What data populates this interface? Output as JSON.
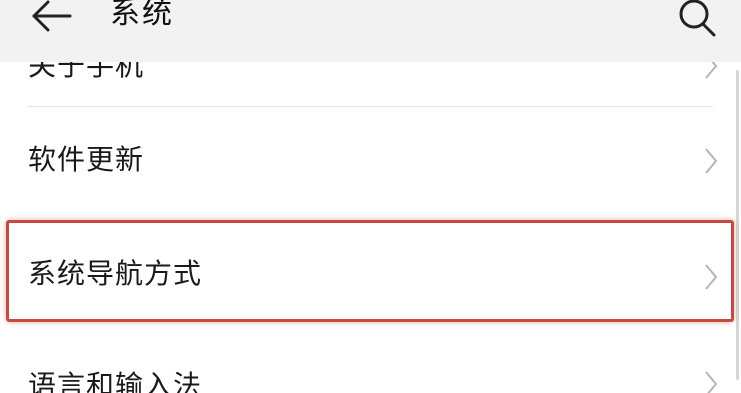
{
  "header": {
    "title": "系统",
    "back_icon": "arrow-left-icon",
    "search_icon": "search-icon"
  },
  "list": {
    "items": [
      {
        "label": "关于手机",
        "icon": "chevron-right-icon"
      },
      {
        "label": "软件更新",
        "icon": "chevron-right-icon"
      },
      {
        "label": "系统导航方式",
        "icon": "chevron-right-icon",
        "highlighted": true
      },
      {
        "label": "语言和输入法",
        "icon": "chevron-right-icon"
      }
    ]
  },
  "colors": {
    "header_bg": "#f2f2f2",
    "highlight": "#c84a3f",
    "chevron": "#b5b5b5",
    "divider": "#e4e4e4"
  }
}
